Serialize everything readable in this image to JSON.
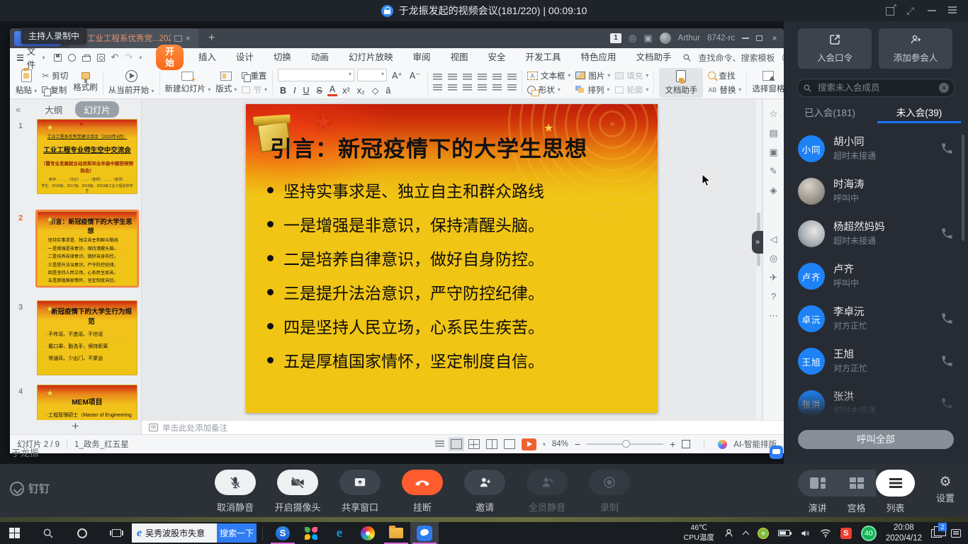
{
  "topbar": {
    "title": "于龙振发起的视频会议(181/220) | 00:09:10"
  },
  "overlay": {
    "recording_tooltip": "主持人录制中",
    "presenter": "于龙振"
  },
  "wps": {
    "logo": "WPS",
    "logo_w": "W",
    "tab_title": "工业工程系优秀党...20200412",
    "titlebar": {
      "badge": "1",
      "user": "Arthur",
      "version": "8742-rc"
    },
    "menu": {
      "file": "文件",
      "items": [
        "开始",
        "插入",
        "设计",
        "切换",
        "动画",
        "幻灯片放映",
        "审阅",
        "视图",
        "安全",
        "开发工具",
        "特色应用",
        "文档助手"
      ],
      "search": "查找命令、搜索模板"
    },
    "ribbon": {
      "paste": "粘贴",
      "cut": "剪切",
      "copy": "复制",
      "format_painter": "格式刷",
      "play_current": "从当前开始",
      "new_slide": "新建幻灯片",
      "layout": "版式",
      "reset": "重置",
      "section": "节",
      "format_glyphs": [
        "B",
        "I",
        "U",
        "S",
        "A",
        "x²",
        "x₂",
        "◇",
        "ā"
      ],
      "textbox": "文本框",
      "shapes": "形状",
      "picture": "图片",
      "fill": "填充",
      "arrange": "排列",
      "outline": "轮廓",
      "assistant": "文档助手",
      "find": "查找",
      "replace": "替换",
      "selection_pane": "选择窗格"
    },
    "panel": {
      "outline_tab": "大纲",
      "slides_tab": "幻灯片",
      "slides": [
        {
          "num": "1",
          "line1": "工业工程系优秀党建日活动（2020年4月）",
          "title": "工业工程专业师生空中交流会",
          "subtitle": "（暨专业发展就业动员和毕业年级中期答辩预热会）",
          "credits1": "制作：……（书记）  ……（老师）  ……（老师）",
          "credits2": "学生：2016级、2017级、2018级、2019级工业工程全体学生"
        },
        {
          "num": "2",
          "title": "引言：新冠疫情下的大学生思想"
        },
        {
          "num": "3",
          "title": "新冠疫情下的大学生行为规范",
          "bullets": [
            "不传谣、不造谣、不信谣",
            "戴口罩、勤洗手、保持距离",
            "常通风、少出门、不聚会"
          ]
        },
        {
          "num": "4",
          "title": "MEM项目",
          "bullets": [
            "工程管理硕士（Master of Engineering Management)"
          ]
        }
      ]
    },
    "slide": {
      "title": "引言：新冠疫情下的大学生思想",
      "bullets": [
        "坚持实事求是、独立自主和群众路线",
        "一是增强是非意识，保持清醒头脑。",
        "二是培养自律意识，做好自身防控。",
        "三是提升法治意识，严守防控纪律。",
        "四是坚持人民立场，心系民生疾苦。",
        "五是厚植国家情怀，坚定制度自信。"
      ]
    },
    "notes_placeholder": "单击此处添加备注",
    "status": {
      "slide_pos": "幻灯片 2 / 9",
      "template": "1_政务_红五星",
      "zoom": "84%",
      "ai": "AI-智能排版"
    }
  },
  "sidebar": {
    "join_code": "入会口令",
    "add_participant": "添加参会人",
    "search_placeholder": "搜索未入会成员",
    "tab_joined": "已入会(181)",
    "tab_not_joined": "未入会(39)",
    "members": [
      {
        "name": "胡小同",
        "avatar_text": "小同",
        "status": "超时未接通"
      },
      {
        "name": "时海涛",
        "avatar_text": "",
        "status": "呼叫中"
      },
      {
        "name": "杨超然妈妈",
        "avatar_text": "",
        "status": "超时未接通"
      },
      {
        "name": "卢齐",
        "avatar_text": "卢齐",
        "status": "呼叫中"
      },
      {
        "name": "李卓沅",
        "avatar_text": "卓沅",
        "status": "对方正忙"
      },
      {
        "name": "王旭",
        "avatar_text": "王旭",
        "status": "对方正忙"
      },
      {
        "name": "张洪",
        "avatar_text": "张洪",
        "status": "超时未接通"
      }
    ],
    "call_all": "呼叫全部"
  },
  "controls": {
    "brand": "钉钉",
    "buttons": [
      {
        "label": "取消静音"
      },
      {
        "label": "开启摄像头"
      },
      {
        "label": "共享窗口"
      },
      {
        "label": "挂断"
      },
      {
        "label": "邀请"
      },
      {
        "label": "全员静音"
      },
      {
        "label": "录制"
      }
    ],
    "views": [
      "演讲",
      "宫格",
      "列表"
    ],
    "settings": "设置"
  },
  "taskbar": {
    "search_text": "吴秀波股市失意",
    "search_button": "搜索一下",
    "cpu_temp": "46℃",
    "cpu_label": "CPU温度",
    "time": "20:08",
    "date": "2020/4/12",
    "window_badge": "2",
    "score": "40"
  }
}
